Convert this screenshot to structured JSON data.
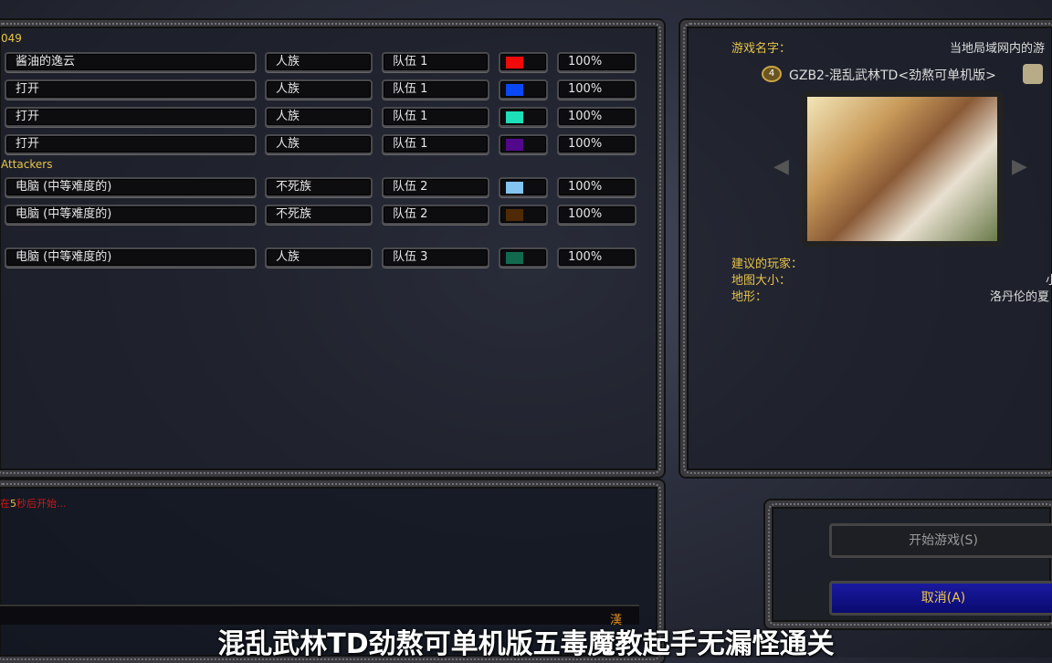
{
  "lobby": {
    "team1_header": "049",
    "team2_header": "Attackers",
    "slots": [
      {
        "name": "酱油的逸云",
        "race": "人族",
        "team": "队伍 1",
        "color": "#f00a0a",
        "handicap": "100%"
      },
      {
        "name": "打开",
        "race": "人族",
        "team": "队伍 1",
        "color": "#0a48f5",
        "handicap": "100%"
      },
      {
        "name": "打开",
        "race": "人族",
        "team": "队伍 1",
        "color": "#1de0b8",
        "handicap": "100%"
      },
      {
        "name": "打开",
        "race": "人族",
        "team": "队伍 1",
        "color": "#52088a",
        "handicap": "100%"
      },
      {
        "name": "电脑 (中等难度的)",
        "race": "不死族",
        "team": "队伍 2",
        "color": "#84c4f0",
        "handicap": "100%"
      },
      {
        "name": "电脑 (中等难度的)",
        "race": "不死族",
        "team": "队伍 2",
        "color": "#4e2a06",
        "handicap": "100%"
      },
      {
        "name": "电脑 (中等难度的)",
        "race": "人族",
        "team": "队伍 3",
        "color": "#126a4e",
        "handicap": "100%"
      }
    ]
  },
  "map_info": {
    "game_name_label": "游戏名字：",
    "game_name_value": "当地局域网内的游",
    "player_count": "4",
    "map_name": "GZB2-混乱武林TD<劲熬可单机版>",
    "suggested_players_label": "建议的玩家：",
    "map_size_label": "地图大小：",
    "map_size_value": "小",
    "terrain_label": "地形：",
    "terrain_value": "洛丹伦的夏"
  },
  "chat": {
    "countdown_prefix": "在",
    "countdown_num": "5",
    "countdown_suffix": "秒后开始...",
    "input_indicator": "漢"
  },
  "buttons": {
    "start": "开始游戏(S)",
    "cancel": "取消(A)"
  },
  "subtitle": "混乱武林TD劲熬可单机版五毒魔教起手无漏怪通关"
}
